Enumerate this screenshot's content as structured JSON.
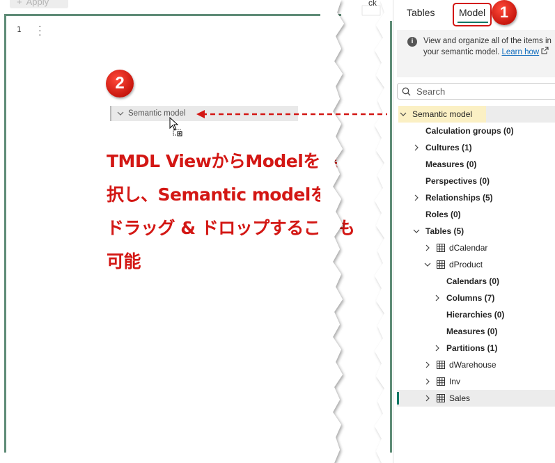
{
  "toolbar": {
    "apply_label": "Apply",
    "back_label": "ck"
  },
  "editor": {
    "line_number": "1",
    "drag_item_label": "Semantic model"
  },
  "annotation": {
    "badge_left": "2",
    "badge_right": "1",
    "lines": [
      "TMDL ViewからModelを選",
      "択し、Semantic modelを",
      "ドラッグ & ドロップすることも",
      "可能"
    ],
    "color": "#d31714"
  },
  "model_pane": {
    "tabs": [
      "Tables",
      "Model"
    ],
    "active_tab": "Model",
    "info_text": "View and organize all of the items in your semantic model.",
    "info_link": "Learn how",
    "search_placeholder": "Search",
    "tree": {
      "root": "Semantic model",
      "calculation_groups": "Calculation groups (0)",
      "cultures": "Cultures (1)",
      "measures": "Measures (0)",
      "perspectives": "Perspectives (0)",
      "relationships": "Relationships (5)",
      "roles": "Roles (0)",
      "tables": "Tables (5)",
      "dcalendar": "dCalendar",
      "dproduct": "dProduct",
      "calendars": "Calendars (0)",
      "columns": "Columns (7)",
      "hierarchies": "Hierarchies (0)",
      "product_measures": "Measures (0)",
      "partitions": "Partitions (1)",
      "dwarehouse": "dWarehouse",
      "inv": "Inv",
      "sales": "Sales"
    }
  },
  "colors": {
    "accent": "#117865",
    "highlight_red": "#d31714",
    "root_highlight": "#fbf0c4"
  }
}
